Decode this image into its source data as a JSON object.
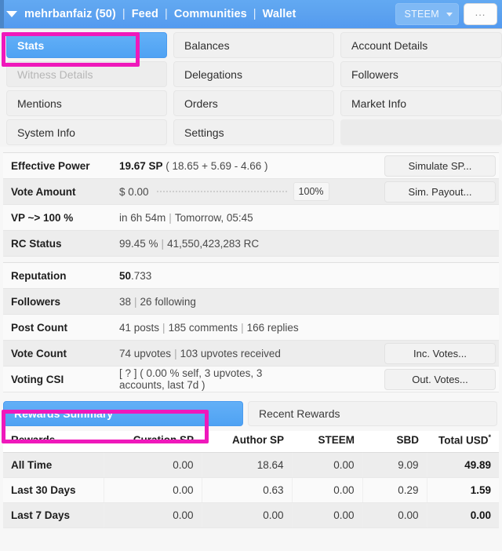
{
  "header": {
    "caret_icon": "chevron-down-icon",
    "account": "mehrbanfaiz (50)",
    "separator": "|",
    "nav": [
      {
        "label": "Feed"
      },
      {
        "label": "Communities"
      },
      {
        "label": "Wallet"
      }
    ],
    "currency_select": {
      "value": "STEEM",
      "caret_icon": "caret-down-icon"
    },
    "overflow_button": "..."
  },
  "tabs": [
    {
      "label": "Stats",
      "state": "active"
    },
    {
      "label": "Balances",
      "state": "normal"
    },
    {
      "label": "Account Details",
      "state": "normal"
    },
    {
      "label": "Witness Details",
      "state": "disabled"
    },
    {
      "label": "Delegations",
      "state": "normal"
    },
    {
      "label": "Followers",
      "state": "normal"
    },
    {
      "label": "Mentions",
      "state": "normal"
    },
    {
      "label": "Orders",
      "state": "normal"
    },
    {
      "label": "Market Info",
      "state": "normal"
    },
    {
      "label": "System Info",
      "state": "normal"
    },
    {
      "label": "Settings",
      "state": "normal"
    },
    {
      "label": "",
      "state": "empty"
    }
  ],
  "stats_primary": [
    {
      "label": "Effective Power",
      "value_strong": "19.67 SP",
      "value_rest": " ( 18.65 + 5.69 - 4.66 )",
      "button": "Simulate SP..."
    },
    {
      "label": "Vote Amount",
      "amount": "$ 0.00",
      "slider_percent": "100%",
      "button": "Sim. Payout..."
    },
    {
      "label": "VP ~> 100 %",
      "part_a": "in 6h 54m",
      "part_b": "Tomorrow, 05:45"
    },
    {
      "label": "RC Status",
      "part_a": "99.45 %",
      "part_b": "41,550,423,283 RC"
    }
  ],
  "stats_secondary": [
    {
      "label": "Reputation",
      "value_strong": "50",
      "value_rest": ".733"
    },
    {
      "label": "Followers",
      "parts": [
        "38",
        "26 following"
      ]
    },
    {
      "label": "Post Count",
      "parts": [
        "41 posts",
        "185 comments",
        "166 replies"
      ]
    },
    {
      "label": "Vote Count",
      "parts": [
        "74 upvotes",
        "103 upvotes received"
      ],
      "button": "Inc. Votes..."
    },
    {
      "label": "Voting CSI",
      "value": "[ ? ] ( 0.00 % self, 3 upvotes, 3 accounts, last 7d )",
      "button": "Out. Votes..."
    }
  ],
  "reward_tabs": [
    {
      "label": "Rewards Summary",
      "state": "active"
    },
    {
      "label": "Recent Rewards",
      "state": "normal"
    }
  ],
  "rewards_table": {
    "columns": [
      "Rewards",
      "Curation SP",
      "Author SP",
      "STEEM",
      "SBD",
      "Total USD"
    ],
    "total_usd_marker": "*",
    "rows": [
      {
        "period": "All Time",
        "curation_sp": "0.00",
        "author_sp": "18.64",
        "steem": "0.00",
        "sbd": "9.09",
        "total_usd": "49.89"
      },
      {
        "period": "Last 30 Days",
        "curation_sp": "0.00",
        "author_sp": "0.63",
        "steem": "0.00",
        "sbd": "0.29",
        "total_usd": "1.59"
      },
      {
        "period": "Last 7 Days",
        "curation_sp": "0.00",
        "author_sp": "0.00",
        "steem": "0.00",
        "sbd": "0.00",
        "total_usd": "0.00"
      }
    ]
  },
  "annotations": {
    "color": "#ef18bb",
    "boxes": [
      {
        "target": "Stats"
      },
      {
        "target": "Rewards Summary"
      }
    ]
  }
}
